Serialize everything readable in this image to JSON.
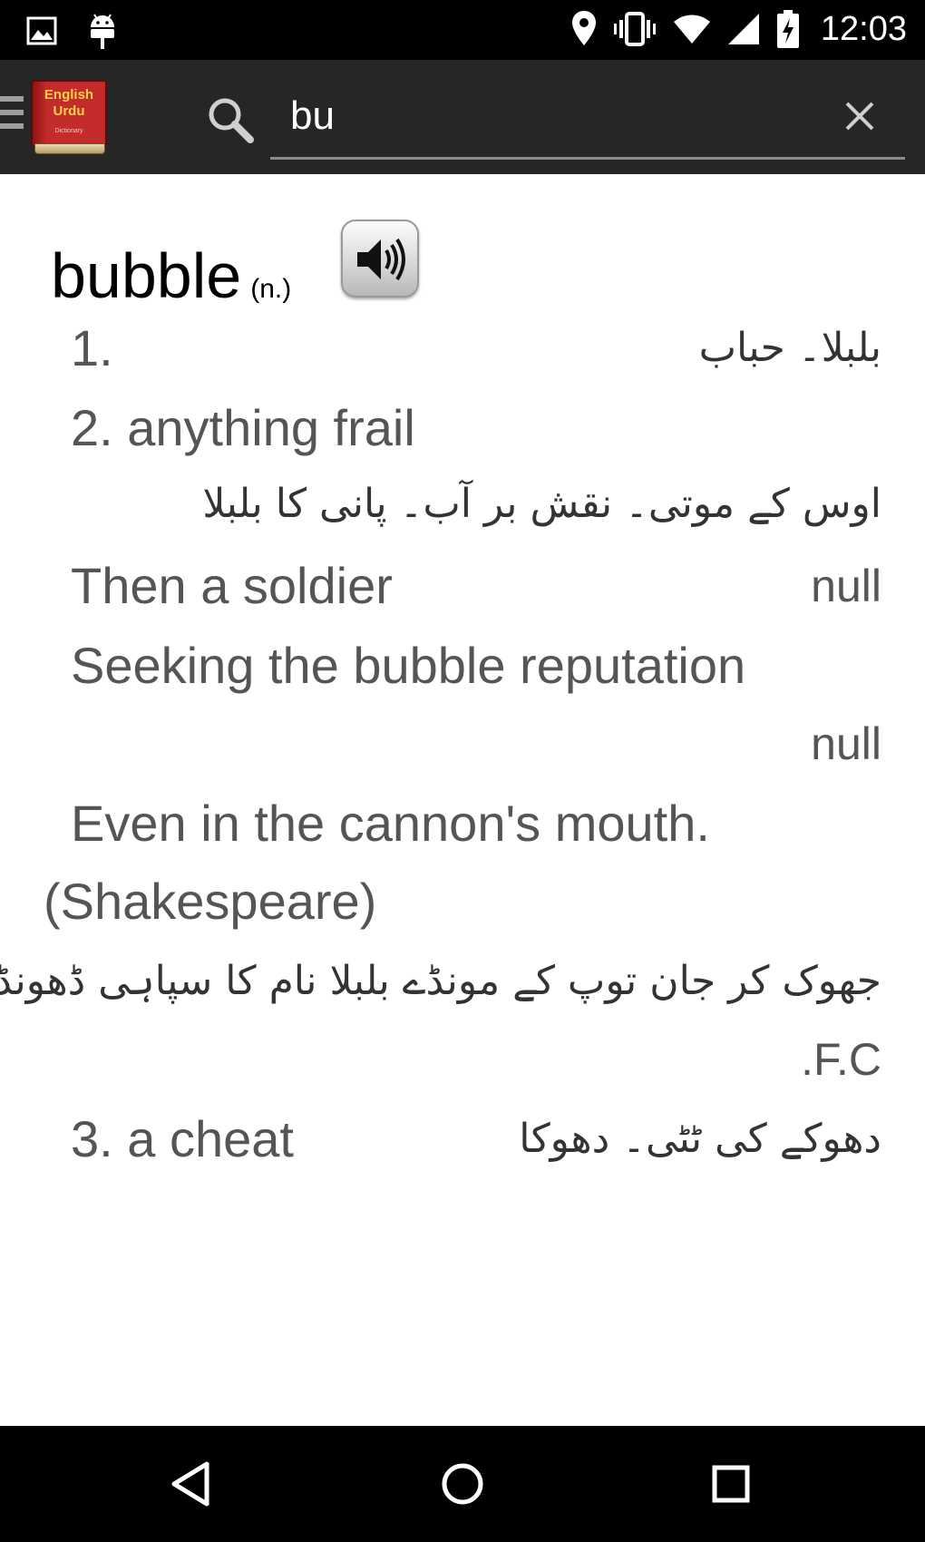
{
  "status_bar": {
    "time": "12:03",
    "icons": [
      "image-icon",
      "android-icon",
      "location-icon",
      "vibrate-icon",
      "wifi-icon",
      "signal-icon",
      "battery-charging-icon"
    ]
  },
  "app_bar": {
    "logo": {
      "line1": "English",
      "line2": "Urdu",
      "line3": "Dictionary"
    },
    "search": {
      "value": "bu",
      "placeholder": ""
    },
    "icons": [
      "menu-icon",
      "search-icon",
      "clear-icon"
    ]
  },
  "entry": {
    "word": "bubble",
    "pos": "(n.)",
    "lines": [
      {
        "en": "1.",
        "ur": "بلبلا۔ حباب"
      },
      {
        "en": "2. anything frail"
      },
      {
        "ur": "اوس کے موتی۔ نقش بر آب۔ پانی کا بلبلا"
      },
      {
        "en": "Then a soldier",
        "note": "null"
      },
      {
        "en": "Seeking the bubble reputation"
      },
      {
        "note": "null"
      },
      {
        "en": "Even in the cannon's mouth."
      },
      {
        "en": "(Shakespeare)"
      },
      {
        "ur": "جھوک کر جان توپ کے مونڈے بلبلا نام کا سپاہی ڈھونڈے"
      },
      {
        "en": ".F.C"
      },
      {
        "en": "3. a cheat",
        "ur": "دھوکے کی ٹٹی۔ دھوکا"
      }
    ]
  },
  "nav_bar": {
    "icons": [
      "back-icon",
      "home-icon",
      "recent-apps-icon"
    ]
  }
}
